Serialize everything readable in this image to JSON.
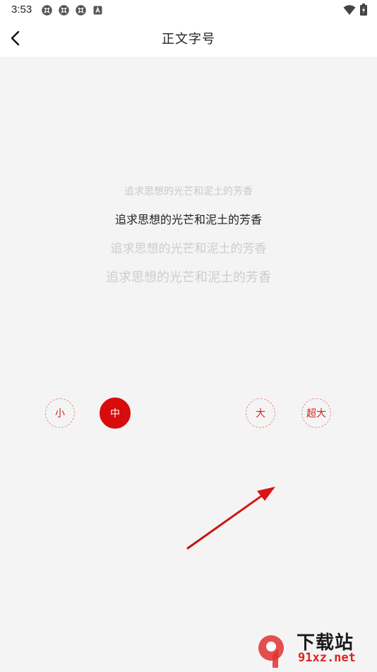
{
  "status_bar": {
    "time": "3:53",
    "notification_icons": [
      "app-notification-icon",
      "app-notification-icon",
      "app-notification-icon",
      "keyboard-a-icon"
    ],
    "right_icons": [
      "wifi-icon",
      "battery-charging-icon"
    ]
  },
  "app_bar": {
    "title": "正文字号",
    "back_icon": "chevron-left-icon"
  },
  "preview": {
    "lines": [
      "追求思想的光芒和泥土的芳香",
      "追求思想的光芒和泥土的芳香",
      "追求思想的光芒和泥土的芳香",
      "追求思想的光芒和泥土的芳香"
    ]
  },
  "font_size_options": [
    {
      "label": "小",
      "selected": false
    },
    {
      "label": "中",
      "selected": true
    },
    {
      "label": "大",
      "selected": false
    },
    {
      "label": "超大",
      "selected": false
    }
  ],
  "watermark": {
    "text": "下载站",
    "url": "91xz.net"
  },
  "colors": {
    "accent": "#d80c0c",
    "background": "#f4f4f4",
    "text_primary": "#222222",
    "text_muted": "#cdcdcd"
  }
}
